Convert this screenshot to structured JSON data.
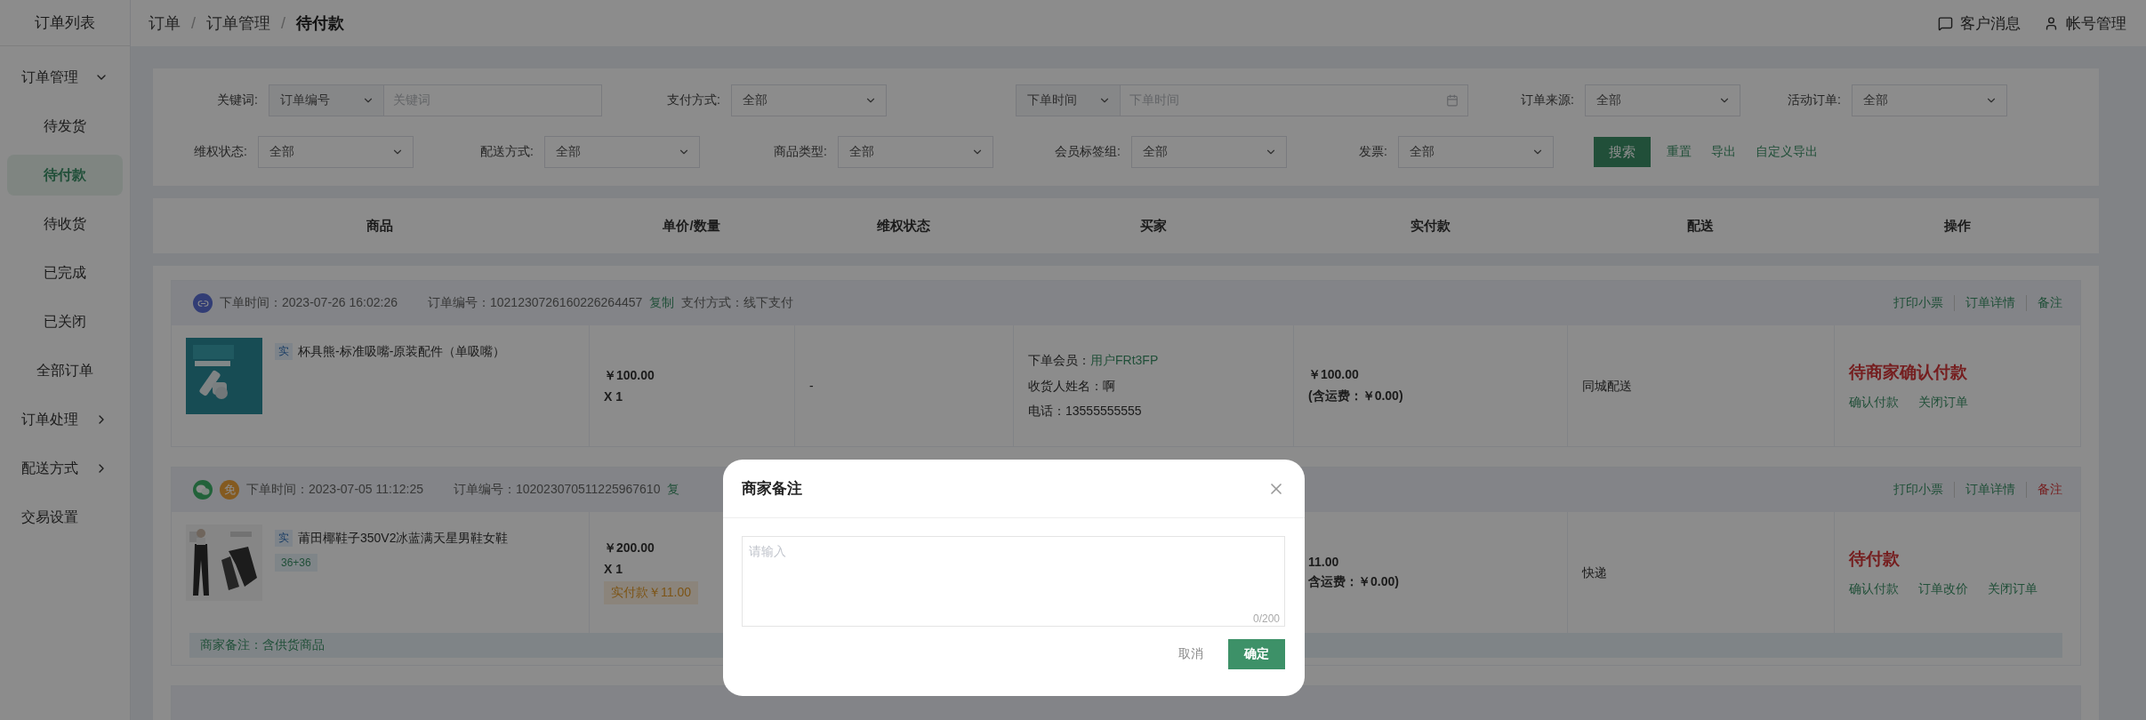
{
  "sidebar": {
    "title": "订单列表",
    "groups": [
      {
        "label": "订单管理",
        "expandable": true,
        "expanded": true,
        "children": [
          {
            "label": "待发货",
            "selected": false
          },
          {
            "label": "待付款",
            "selected": true
          },
          {
            "label": "待收货",
            "selected": false
          },
          {
            "label": "已完成",
            "selected": false
          },
          {
            "label": "已关闭",
            "selected": false
          },
          {
            "label": "全部订单",
            "selected": false
          }
        ]
      },
      {
        "label": "订单处理",
        "expandable": true,
        "expanded": false
      },
      {
        "label": "配送方式",
        "expandable": true,
        "expanded": false
      },
      {
        "label": "交易设置",
        "expandable": false
      }
    ]
  },
  "breadcrumb": {
    "separator": "/",
    "items": [
      {
        "label": "订单",
        "current": false
      },
      {
        "label": "订单管理",
        "current": false
      },
      {
        "label": "待付款",
        "current": true
      }
    ]
  },
  "header_links": [
    {
      "kind": "chat",
      "label": "客户消息"
    },
    {
      "kind": "user",
      "label": "帐号管理"
    }
  ],
  "filters": [
    [
      {
        "kind": "keyword",
        "label": "关键词:",
        "select": "订单编号",
        "placeholder": "关键词"
      },
      {
        "kind": "select",
        "label": "支付方式:",
        "value": "全部"
      },
      {
        "kind": "date",
        "select": "下单时间",
        "placeholder": "下单时间"
      },
      {
        "kind": "select",
        "label": "订单来源:",
        "value": "全部"
      },
      {
        "kind": "select",
        "label": "活动订单:",
        "value": "全部"
      }
    ],
    [
      {
        "kind": "select",
        "label": "维权状态:",
        "value": "全部"
      },
      {
        "kind": "select",
        "label": "配送方式:",
        "value": "全部"
      },
      {
        "kind": "select",
        "label": "商品类型:",
        "value": "全部"
      },
      {
        "kind": "select",
        "label": "会员标签组:",
        "value": "全部"
      },
      {
        "kind": "select",
        "label": "发票:",
        "value": "全部"
      }
    ]
  ],
  "filter_actions": {
    "search": "搜索",
    "links": [
      "重置",
      "导出",
      "自定义导出"
    ]
  },
  "table": {
    "columns": [
      "商品",
      "单价/数量",
      "维权状态",
      "买家",
      "实付款",
      "配送",
      "操作"
    ]
  },
  "orders": [
    {
      "source_icons": [
        {
          "kind": "miniprogram"
        }
      ],
      "time": "下单时间：2023-07-26 16:02:26",
      "number": "订单编号：1021230726160226264457",
      "copy": "复制",
      "payment": "支付方式：线下支付",
      "actions": [
        {
          "label": "打印小票",
          "highlighted": false
        },
        {
          "label": "订单详情",
          "highlighted": false
        },
        {
          "label": "备注",
          "highlighted": false
        }
      ],
      "product": {
        "tag": "实",
        "name": "杯具熊-标准吸嘴-原装配件（单吸嘴）",
        "price": "￥100.00",
        "qty": "X 1"
      },
      "after_sale": "-",
      "buyer": {
        "member_label": "下单会员：",
        "member": "用户FRt3FP",
        "name": "收货人姓名：啊",
        "phone": "电话：13555555555"
      },
      "paid": "￥100.00",
      "shipping_fee": "(含运费：￥0.00)",
      "delivery": "同城配送",
      "status": "待商家确认付款",
      "status_actions": [
        "确认付款",
        "关闭订单"
      ]
    },
    {
      "source_icons": [
        {
          "kind": "wechat"
        },
        {
          "kind": "free",
          "label": "免"
        }
      ],
      "time": "下单时间：2023-07-05 11:12:25",
      "number": "订单编号：102023070511225967610",
      "copy": "复",
      "actions": [
        {
          "label": "打印小票",
          "highlighted": false
        },
        {
          "label": "订单详情",
          "highlighted": false
        },
        {
          "label": "备注",
          "highlighted": true
        }
      ],
      "product": {
        "tag": "实",
        "name": "莆田椰鞋子350V2冰蓝满天星男鞋女鞋",
        "spec": "36+36",
        "price": "￥200.00",
        "qty": "X 1",
        "paid_badge": "实付款￥11.00"
      },
      "paid": "11.00",
      "shipping_fee": "含运费：￥0.00)",
      "delivery": "快递",
      "status": "待付款",
      "status_actions": [
        "确认付款",
        "订单改价",
        "关闭订单"
      ],
      "remark": "商家备注：含供货商品"
    }
  ],
  "modal": {
    "title": "商家备注",
    "placeholder": "请输入",
    "counter": "0/200",
    "cancel": "取消",
    "confirm": "确定"
  }
}
